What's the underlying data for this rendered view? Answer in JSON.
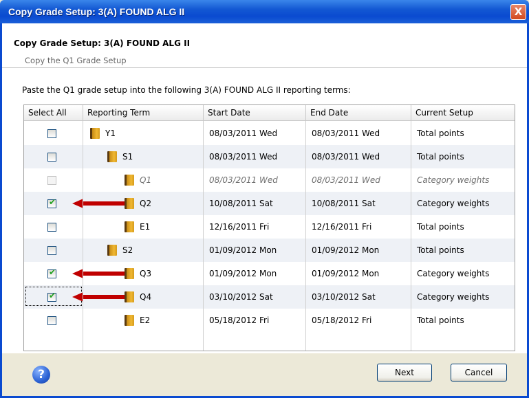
{
  "window": {
    "title": "Copy Grade Setup: 3(A) FOUND ALG II",
    "close_glyph": "X"
  },
  "header": {
    "title": "Copy Grade Setup: 3(A) FOUND ALG II",
    "subtitle": "Copy the Q1 Grade Setup"
  },
  "instruction": "Paste the Q1 grade setup into the following 3(A) FOUND ALG II reporting terms:",
  "table": {
    "columns": [
      "Select All",
      "Reporting Term",
      "Start Date",
      "End Date",
      "Current Setup"
    ],
    "rows": [
      {
        "term": "Y1",
        "indent": 0,
        "start": "08/03/2011 Wed",
        "end": "08/03/2011 Wed",
        "setup": "Total points",
        "checked": false,
        "disabled": false,
        "arrow": false
      },
      {
        "term": "S1",
        "indent": 1,
        "start": "08/03/2011 Wed",
        "end": "08/03/2011 Wed",
        "setup": "Total points",
        "checked": false,
        "disabled": false,
        "arrow": false
      },
      {
        "term": "Q1",
        "indent": 2,
        "start": "08/03/2011 Wed",
        "end": "08/03/2011 Wed",
        "setup": "Category weights",
        "checked": false,
        "disabled": true,
        "arrow": false
      },
      {
        "term": "Q2",
        "indent": 2,
        "start": "10/08/2011 Sat",
        "end": "10/08/2011 Sat",
        "setup": "Category weights",
        "checked": true,
        "disabled": false,
        "arrow": true
      },
      {
        "term": "E1",
        "indent": 2,
        "start": "12/16/2011 Fri",
        "end": "12/16/2011 Fri",
        "setup": "Total points",
        "checked": false,
        "disabled": false,
        "arrow": false
      },
      {
        "term": "S2",
        "indent": 1,
        "start": "01/09/2012 Mon",
        "end": "01/09/2012 Mon",
        "setup": "Total points",
        "checked": false,
        "disabled": false,
        "arrow": false
      },
      {
        "term": "Q3",
        "indent": 2,
        "start": "01/09/2012 Mon",
        "end": "01/09/2012 Mon",
        "setup": "Category weights",
        "checked": true,
        "disabled": false,
        "arrow": true
      },
      {
        "term": "Q4",
        "indent": 2,
        "start": "03/10/2012 Sat",
        "end": "03/10/2012 Sat",
        "setup": "Category weights",
        "checked": true,
        "disabled": false,
        "arrow": true,
        "focused": true
      },
      {
        "term": "E2",
        "indent": 2,
        "start": "05/18/2012 Fri",
        "end": "05/18/2012 Fri",
        "setup": "Total points",
        "checked": false,
        "disabled": false,
        "arrow": false
      }
    ]
  },
  "footer": {
    "help_glyph": "?",
    "next_label": "Next",
    "cancel_label": "Cancel"
  },
  "colors": {
    "titlebar": "#0a4ad0",
    "arrow": "#c00000",
    "check": "#21a121",
    "folder": "#f0b832"
  }
}
